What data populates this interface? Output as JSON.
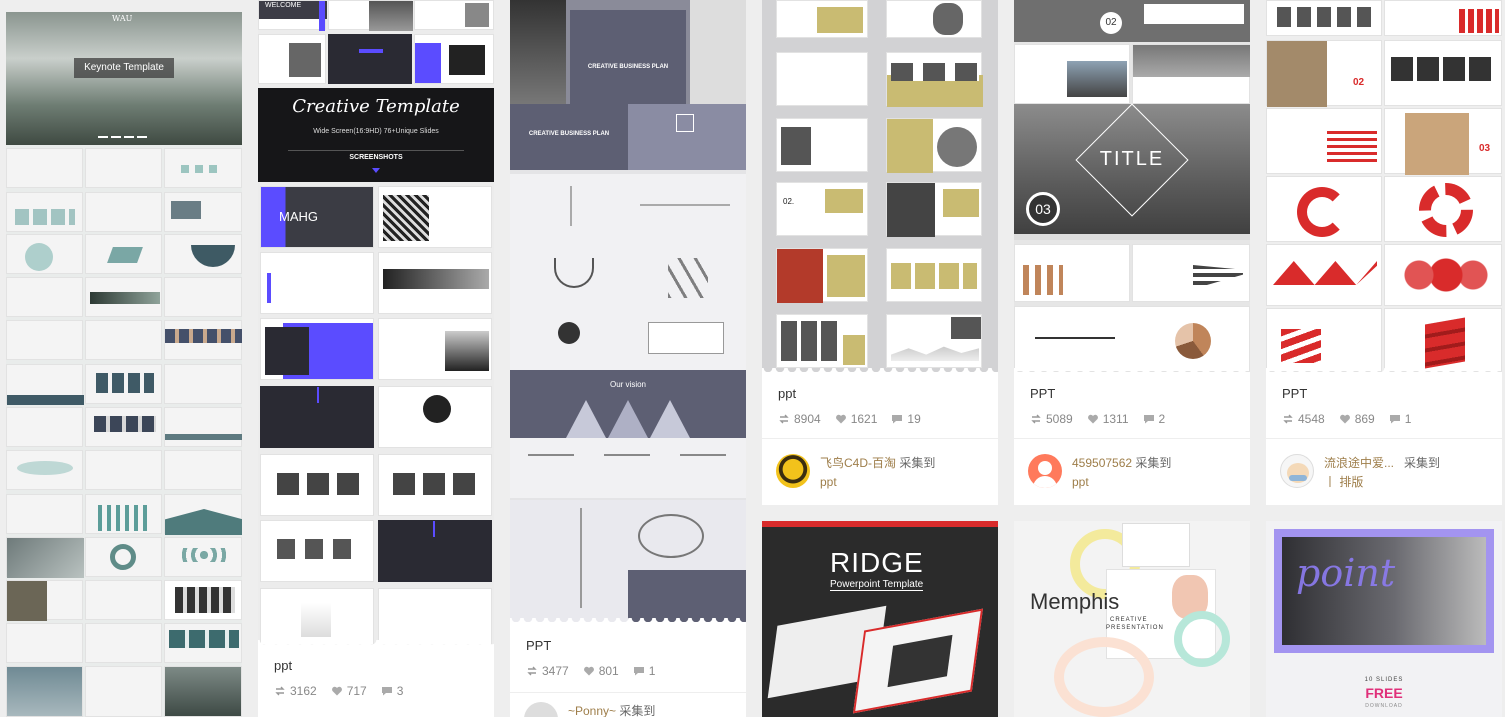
{
  "cards": [
    {
      "id": "col1",
      "hero_title": "Keynote Template",
      "hero_logo": "WAU"
    },
    {
      "id": "col2",
      "welcome": "WELCOME",
      "banner_title": "Creative Template",
      "banner_sub": "Wide Screen(16:9HD)  76+Unique Slides",
      "banner_shots": "SCREENSHOTS",
      "mahg": "MAHG",
      "title": "ppt",
      "repins": "3162",
      "likes": "717",
      "comments": "3"
    },
    {
      "id": "col3",
      "plan_title": "CREATIVE BUSINESS PLAN",
      "plan_title2": "CREATIVE BUSINESS PLAN",
      "vision": "Our vision",
      "title": "PPT",
      "repins": "3477",
      "likes": "801",
      "comments": "1",
      "pin_user": "~Ponny~",
      "pin_action": "采集到"
    },
    {
      "id": "col4",
      "title": "ppt",
      "repins": "8904",
      "likes": "1621",
      "comments": "19",
      "pin_user": "飞鸟C4D-百淘",
      "pin_action": "采集到",
      "pin_board": "ppt",
      "accent": "#c9bb72"
    },
    {
      "id": "col5",
      "big_title": "TITLE",
      "num_02": "02",
      "num_03": "03",
      "title": "PPT",
      "repins": "5089",
      "likes": "1311",
      "comments": "2",
      "pin_user": "459507562",
      "pin_action": "采集到",
      "pin_board": "ppt"
    },
    {
      "id": "col6",
      "num_02": "02",
      "num_03": "03",
      "title": "PPT",
      "repins": "4548",
      "likes": "869",
      "comments": "1",
      "pin_user": "流浪途中爱...",
      "pin_action": "采集到",
      "pin_board": "丨 排版",
      "accent": "#d92b2b"
    },
    {
      "id": "col4b",
      "brand": "RIDGE",
      "sub": "Powerpoint Template"
    },
    {
      "id": "col5b",
      "brand": "Memphis",
      "sub1": "CREATIVE",
      "sub2": "PRESENTATION"
    },
    {
      "id": "col6b",
      "script": "point",
      "slides": "10 SLIDES",
      "free": "FREE",
      "download": "DOWNLOAD"
    }
  ],
  "colors": {
    "link": "#9e7e4a",
    "red": "#d92b2b",
    "purple": "#5b4cff",
    "slate": "#5d5f73"
  },
  "icons": [
    "repin-icon",
    "heart-icon",
    "comment-icon"
  ]
}
